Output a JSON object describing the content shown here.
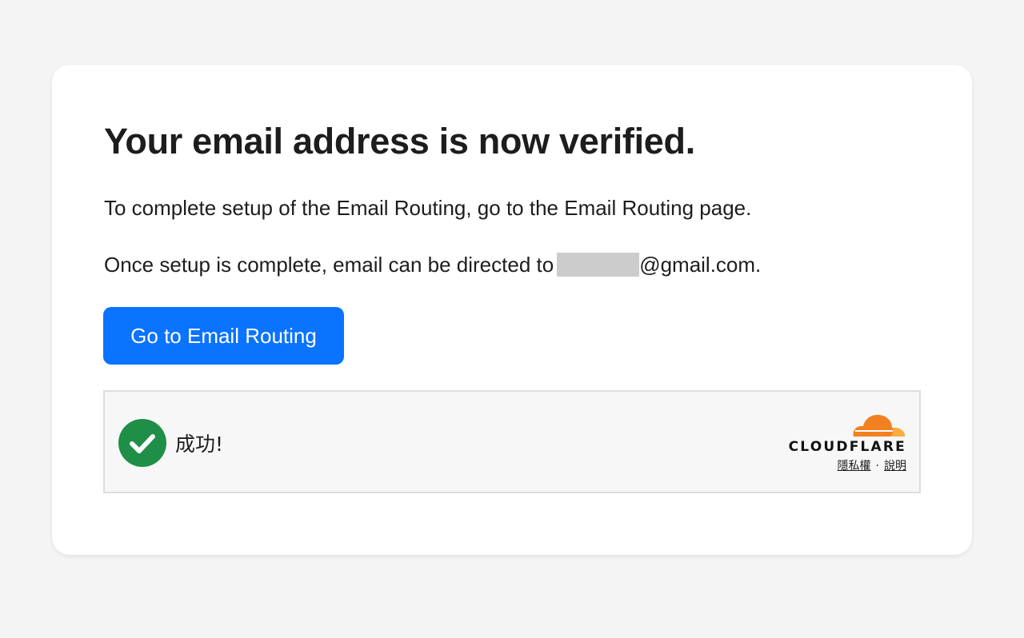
{
  "card": {
    "title": "Your email address is now verified.",
    "paragraph1": "To complete setup of the Email Routing, go to the Email Routing page.",
    "paragraph2_prefix": "Once setup is complete, email can be directed to",
    "paragraph2_suffix": "@gmail.com.",
    "button_label": "Go to Email Routing"
  },
  "widget": {
    "status_icon": "check-circle-icon",
    "status_text": "成功!",
    "brand_logo": "cloudflare-logo",
    "brand_name": "CLOUDFLARE",
    "privacy_link": "隱私權",
    "separator": "·",
    "help_link": "說明"
  },
  "colors": {
    "page_background": "#f4f4f4",
    "card_background": "#ffffff",
    "primary_button": "#0a73ff",
    "success_green": "#1f8f47",
    "cloudflare_orange": "#f38020",
    "cloudflare_light_orange": "#faad3f",
    "redaction_gray": "#cccccc"
  }
}
